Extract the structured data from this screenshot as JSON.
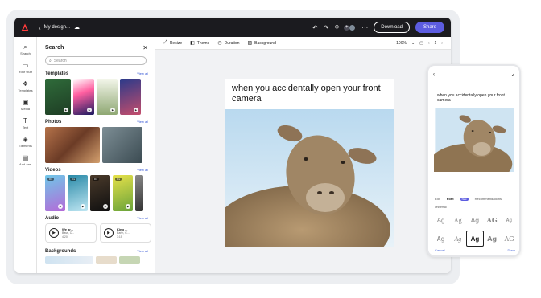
{
  "topbar": {
    "doc_name": "My design...",
    "download_label": "Download",
    "share_label": "Share"
  },
  "nav": {
    "items": [
      {
        "label": "Search",
        "icon": "search-icon"
      },
      {
        "label": "Your stuff",
        "icon": "folder-icon"
      },
      {
        "label": "Templates",
        "icon": "templates-icon"
      },
      {
        "label": "Media",
        "icon": "media-icon"
      },
      {
        "label": "Text",
        "icon": "text-icon"
      },
      {
        "label": "Elements",
        "icon": "elements-icon"
      },
      {
        "label": "Add-ons",
        "icon": "addons-icon"
      }
    ]
  },
  "panel": {
    "title": "Search",
    "search_placeholder": "Search",
    "sections": {
      "templates": {
        "title": "Templates",
        "link": "View all"
      },
      "photos": {
        "title": "Photos",
        "link": "View all"
      },
      "videos": {
        "title": "Videos",
        "link": "View all"
      },
      "audio": {
        "title": "Audio",
        "link": "View all"
      },
      "backgrounds": {
        "title": "Backgrounds",
        "link": "View all"
      }
    },
    "video_badges": [
      "0:s",
      "0:s",
      "0:s",
      "0:s"
    ],
    "audio": [
      {
        "title": "We ar...",
        "artist": "Bass, C...",
        "duration": "4:20"
      },
      {
        "title": "King ...",
        "artist": "Earth, C...",
        "duration": "3:15"
      }
    ]
  },
  "toolbar": {
    "resize": "Resize",
    "theme": "Theme",
    "duration": "Duration",
    "background": "Background",
    "zoom": "100%",
    "page_count": "1"
  },
  "canvas": {
    "caption": "when you accidentally open your front camera"
  },
  "phone": {
    "caption": "when you accidentally open your front camera",
    "tabs": [
      "Edit",
      "Font",
      "New",
      "Recommendations"
    ],
    "sub_label": "Universal",
    "font_glyph": "Ag",
    "fonts": [
      "Ag",
      "Ag",
      "Ag",
      "AG",
      "Ag",
      "Ag",
      "Ag",
      "Ag",
      "Ag",
      "AG"
    ],
    "cancel_label": "Cancel",
    "done_label": "Done"
  }
}
